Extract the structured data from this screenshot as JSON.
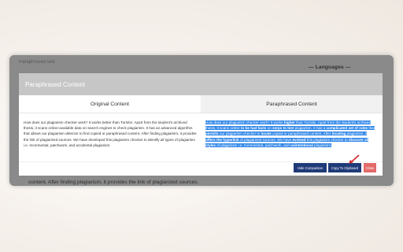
{
  "background": {
    "under_label": "Paraphrased text",
    "languages_label": "— Languages —",
    "bottom_text": "content. After finding plagiarism, it provides the link of plagiarized sources."
  },
  "modal": {
    "title": "Paraphrased Content",
    "original_header": "Original Content",
    "paraphrased_header": "Paraphrased Content",
    "original_text": "How does our plagiarism checker work? It works better than Turnitin. Apart from the student's archived thesis, it scans online-available data on search engines to check plagiarism. It has an advanced algorithm that allows our plagiarism detector to find copied or paraphrased content. After finding plagiarism, it provides the link of plagiarized sources. We have developed this plagiarism checker to identify all types of plagiarism i.e. Incremental, patchwork, and accidental plagiarism.",
    "paraphrased_segments": [
      {
        "text": "How does our plagiarism checker work? It works ",
        "bold": false
      },
      {
        "text": "higher",
        "bold": true
      },
      {
        "text": " than Turnitin. Apart from the student's archived thesis, it scans online ",
        "bold": false
      },
      {
        "text": "to be had facts",
        "bold": true
      },
      {
        "text": " on ",
        "bold": false
      },
      {
        "text": "serps to test",
        "bold": true
      },
      {
        "text": " plagiarism. It has a ",
        "bold": false
      },
      {
        "text": "complicated set of rules",
        "bold": true
      },
      {
        "text": " that ",
        "bold": false
      },
      {
        "text": "permits",
        "bold": true
      },
      {
        "text": " our plagiarism checker to ",
        "bold": false
      },
      {
        "text": "locate",
        "bold": true
      },
      {
        "text": " copied or paraphrased content. After ",
        "bold": false
      },
      {
        "text": "locating",
        "bold": true
      },
      {
        "text": " plagiarism, it ",
        "bold": false
      },
      {
        "text": "offers the hyperlink",
        "bold": true
      },
      {
        "text": " of plagiarized sources. We have ",
        "bold": false
      },
      {
        "text": "evolved",
        "bold": true
      },
      {
        "text": " this plagiarism checker to ",
        "bold": false
      },
      {
        "text": "discover all styles",
        "bold": true
      },
      {
        "text": " of plagiarism i.e. Incremental, patchwork, and ",
        "bold": false
      },
      {
        "text": "unintentional",
        "bold": true
      },
      {
        "text": " plagiarism.",
        "bold": false
      }
    ],
    "buttons": {
      "hide_label": "Hide Comparison",
      "copy_label": "Copy To Clipboard",
      "close_label": "Close"
    }
  },
  "colors": {
    "header_bg": "#c6c6c6",
    "highlight": "#2f86e8",
    "button_primary": "#1f3a78",
    "button_close": "#e26a6a",
    "arrow": "#d8262b"
  },
  "icons": {
    "pointer_arrow": "arrow-icon"
  }
}
